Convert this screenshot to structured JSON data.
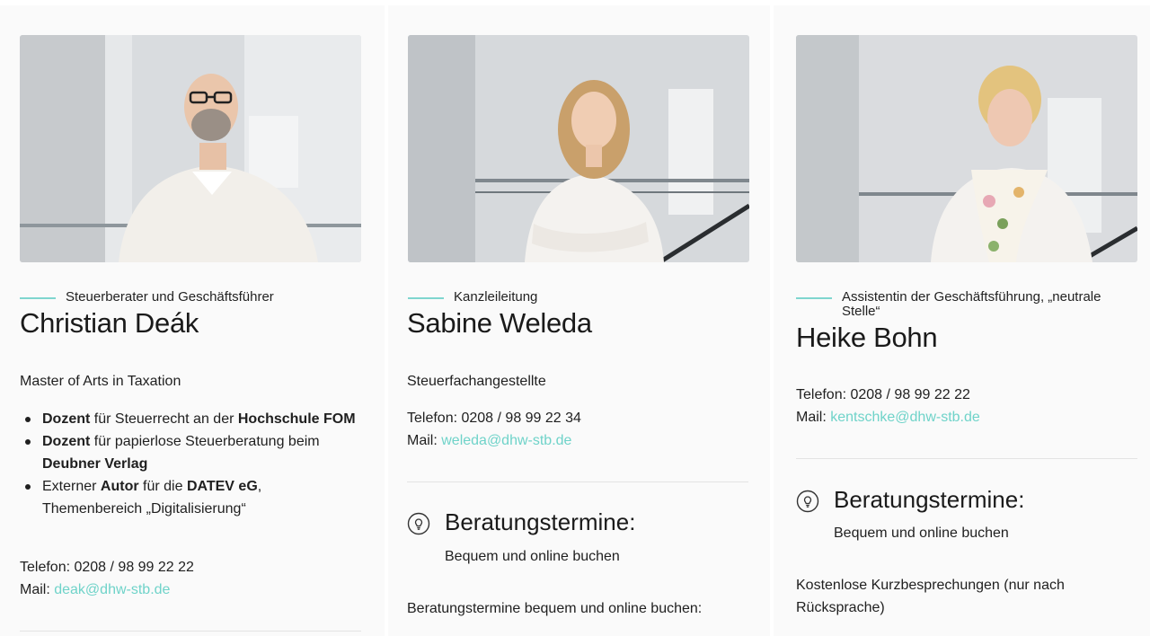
{
  "colors": {
    "accent": "#6fd3c9",
    "background": "#ffffff",
    "card": "#fafafa"
  },
  "team": [
    {
      "role": "Steuerberater und Geschäftsführer",
      "name": "Christian Deák",
      "degree": "Master of Arts in Taxation",
      "bullets": [
        [
          "Dozent",
          " für Steuerrecht an der ",
          "Hochschule FOM"
        ],
        [
          "Dozent",
          " für papierlose Steuerberatung beim ",
          "Deubner Verlag"
        ],
        [
          "Externer ",
          "Autor",
          " für die ",
          "DATEV eG",
          ", Themenbereich „Digitalisierung“"
        ]
      ],
      "phone": "Telefon: 0208 / 98 99 22 22",
      "mail_label": "Mail: ",
      "mail": "deak@dhw-stb.de"
    },
    {
      "role": "Kanzleileitung",
      "name": "Sabine Weleda",
      "degree": "Steuerfachangestellte",
      "phone": "Telefon: 0208 / 98 99 22 34",
      "mail_label": "Mail: ",
      "mail": "weleda@dhw-stb.de",
      "booking_title": "Beratungstermine:",
      "booking_sub": "Bequem und online buchen",
      "booking_note": "Beratungstermine bequem und online buchen:",
      "booking_icon": "lightbulb-icon"
    },
    {
      "role": "Assistentin der Geschäftsführung, „neutrale Stelle“",
      "name": "Heike Bohn",
      "phone": "Telefon: 0208 / 98 99 22 22",
      "mail_label": "Mail: ",
      "mail": "kentschke@dhw-stb.de",
      "booking_title": "Beratungstermine:",
      "booking_sub": "Bequem und online buchen",
      "booking_note": "Kostenlose Kurzbesprechungen (nur nach Rücksprache)",
      "booking_icon": "lightbulb-icon"
    }
  ]
}
